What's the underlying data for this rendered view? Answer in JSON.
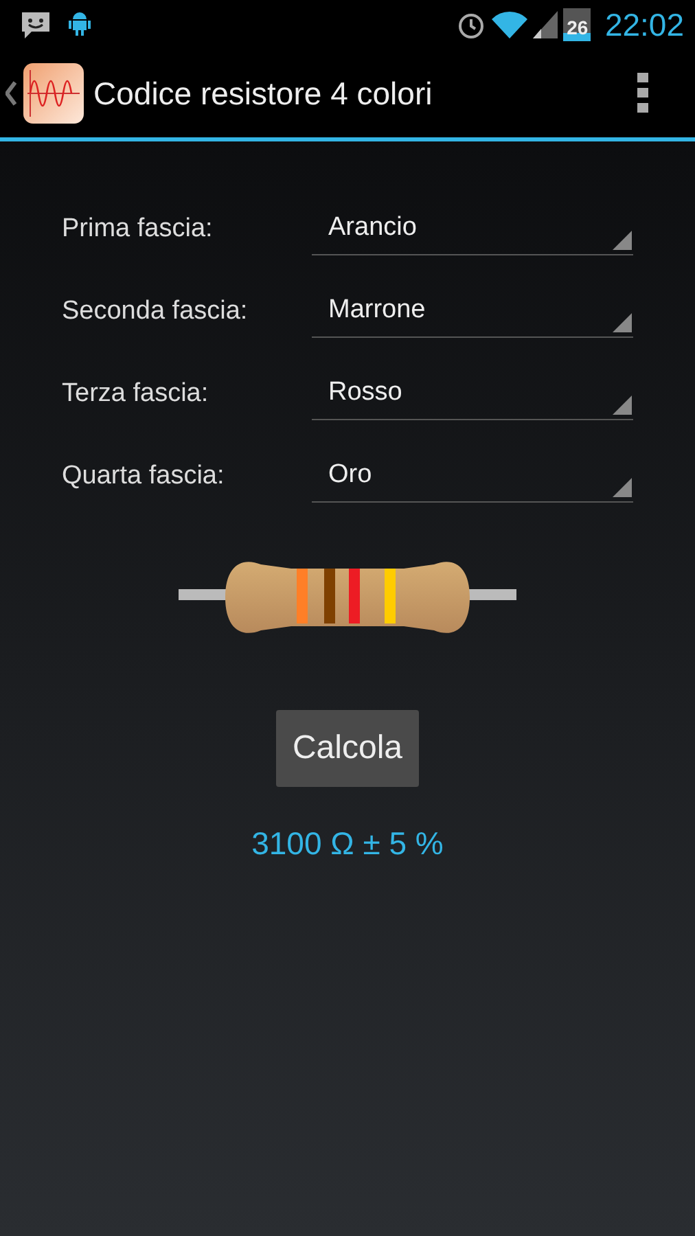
{
  "status_bar": {
    "battery": "26",
    "time": "22:02"
  },
  "action_bar": {
    "title": "Codice resistore 4 colori"
  },
  "bands": [
    {
      "label": "Prima fascia:",
      "value": "Arancio",
      "color": "#ff7f27"
    },
    {
      "label": "Seconda fascia:",
      "value": "Marrone",
      "color": "#7f4000"
    },
    {
      "label": "Terza fascia:",
      "value": "Rosso",
      "color": "#ed1c24"
    },
    {
      "label": "Quarta fascia:",
      "value": "Oro",
      "color": "#ffcc00"
    }
  ],
  "button": "Calcola",
  "result": "3100 Ω ± 5 %"
}
